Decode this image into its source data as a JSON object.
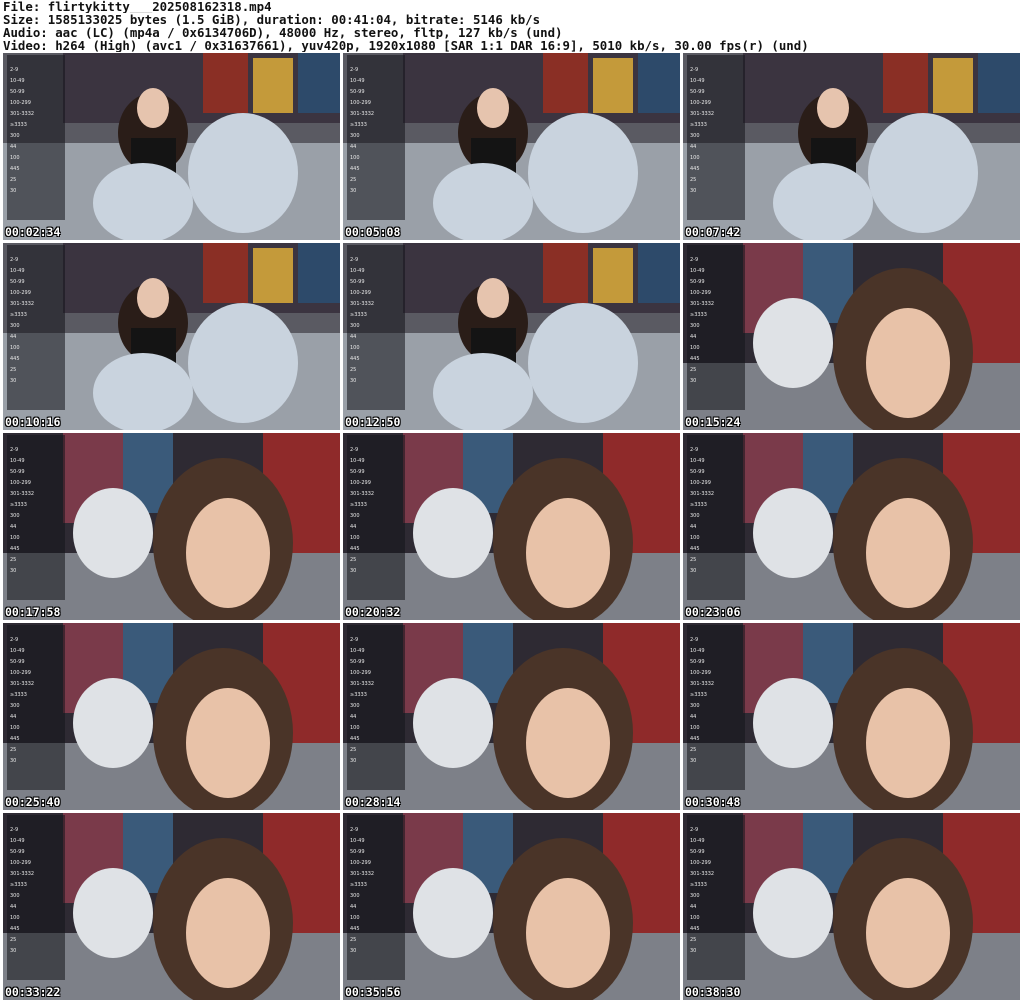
{
  "file_info": {
    "line1": "File: flirtykitty___202508162318.mp4",
    "line2": "Size: 1585133025 bytes (1.5 GiB), duration: 00:41:04, bitrate: 5146 kb/s",
    "line3": "Audio: aac (LC) (mp4a / 0x6134706D), 48000 Hz, stereo, fltp, 127 kb/s (und)",
    "line4": "Video: h264 (High) (avc1 / 0x31637661), yuv420p, 1920x1080 [SAR 1:1 DAR 16:9], 5010 kb/s, 30.00 fps(r) (und)"
  },
  "thumbnails": [
    {
      "timestamp": "00:02:34",
      "scene": "wide"
    },
    {
      "timestamp": "00:05:08",
      "scene": "wide"
    },
    {
      "timestamp": "00:07:42",
      "scene": "wide"
    },
    {
      "timestamp": "00:10:16",
      "scene": "wide"
    },
    {
      "timestamp": "00:12:50",
      "scene": "wide"
    },
    {
      "timestamp": "00:15:24",
      "scene": "close"
    },
    {
      "timestamp": "00:17:58",
      "scene": "close"
    },
    {
      "timestamp": "00:20:32",
      "scene": "close"
    },
    {
      "timestamp": "00:23:06",
      "scene": "close"
    },
    {
      "timestamp": "00:25:40",
      "scene": "close"
    },
    {
      "timestamp": "00:28:14",
      "scene": "close"
    },
    {
      "timestamp": "00:30:48",
      "scene": "close"
    },
    {
      "timestamp": "00:33:22",
      "scene": "close"
    },
    {
      "timestamp": "00:35:56",
      "scene": "close"
    },
    {
      "timestamp": "00:38:30",
      "scene": "close"
    }
  ],
  "overlay_rows": [
    "2-9",
    "10-49",
    "50-99",
    "100-299",
    "301-3332",
    "≥3333",
    "300",
    "44",
    "100",
    "445",
    "25",
    "30"
  ],
  "colors": {
    "background": "#ffffff",
    "thumb_bg": "#3a3a3e",
    "timestamp": "#ffffff"
  }
}
